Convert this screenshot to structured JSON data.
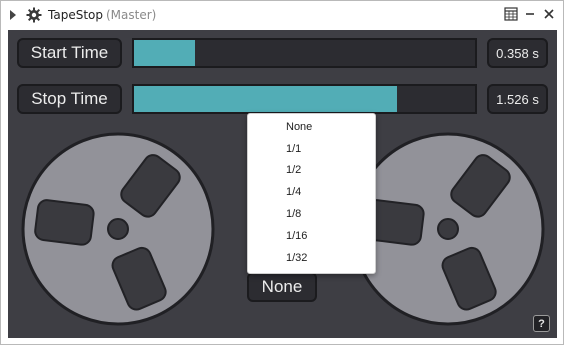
{
  "window": {
    "title": "TapeStop",
    "subtitle": "(Master)"
  },
  "titlebar_icons": [
    "expand-arrow-icon",
    "gear-icon",
    "grid-view-icon",
    "minimize-icon",
    "close-icon"
  ],
  "start_time": {
    "label": "Start Time",
    "value": "0.358 s",
    "bar_fraction": 0.18
  },
  "stop_time": {
    "label": "Stop Time",
    "value": "1.526 s",
    "bar_fraction": 0.77
  },
  "sync_dropdown": {
    "selected": "None",
    "options": [
      "None",
      "1/1",
      "1/2",
      "1/4",
      "1/8",
      "1/16",
      "1/32"
    ]
  },
  "help": {
    "label": "?"
  },
  "colors": {
    "panel": "#3e3e44",
    "bar_fill": "#52adb6",
    "reel": "#929299",
    "control_bg": "#2c2c31"
  }
}
